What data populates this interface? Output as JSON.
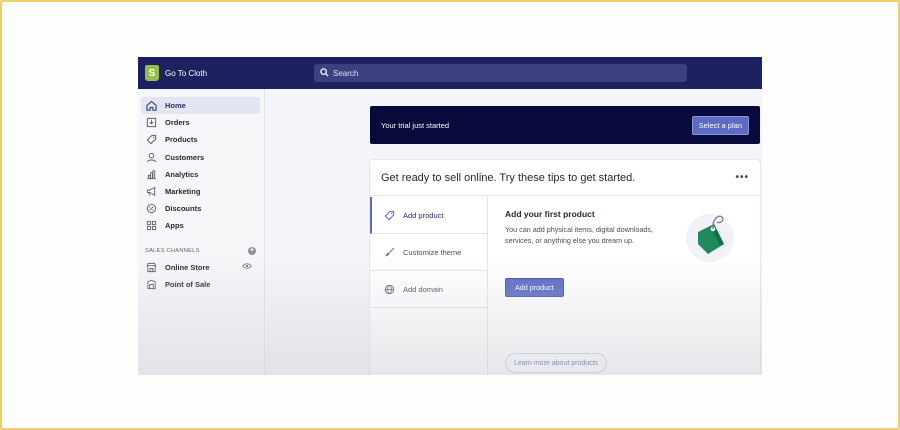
{
  "topbar": {
    "store_name": "Go To Cloth",
    "logo_letter": "S",
    "search_placeholder": "Search",
    "bar_color": "#1c2260"
  },
  "sidebar": {
    "items": [
      {
        "label": "Home",
        "icon": "home-icon",
        "active": true
      },
      {
        "label": "Orders",
        "icon": "orders-icon"
      },
      {
        "label": "Products",
        "icon": "tag-icon"
      },
      {
        "label": "Customers",
        "icon": "person-icon"
      },
      {
        "label": "Analytics",
        "icon": "bar-chart-icon"
      },
      {
        "label": "Marketing",
        "icon": "megaphone-icon"
      },
      {
        "label": "Discounts",
        "icon": "discount-icon"
      },
      {
        "label": "Apps",
        "icon": "apps-icon"
      }
    ],
    "sales_channels_heading": "SALES CHANNELS",
    "channels": [
      {
        "label": "Online Store",
        "icon": "store-icon"
      },
      {
        "label": "Point of Sale",
        "icon": "pos-icon"
      }
    ]
  },
  "trial": {
    "message": "Your trial just started",
    "button_label": "Select a plan"
  },
  "card": {
    "title": "Get ready to sell online. Try these tips to get started.",
    "more_label": "•••",
    "tabs": [
      {
        "label": "Add product",
        "icon": "tag-icon",
        "active": true
      },
      {
        "label": "Customize theme",
        "icon": "brush-icon"
      },
      {
        "label": "Add domain",
        "icon": "globe-icon"
      }
    ],
    "detail_title": "Add your first product",
    "detail_text": "You can add physical items, digital downloads, services, or anything else you dream up.",
    "primary_button": "Add product",
    "learn_more": "Learn more about products"
  },
  "colors": {
    "accent": "#5c6ac4",
    "tag_green": "#1f8a5c",
    "trial_bg": "#070a3b"
  }
}
